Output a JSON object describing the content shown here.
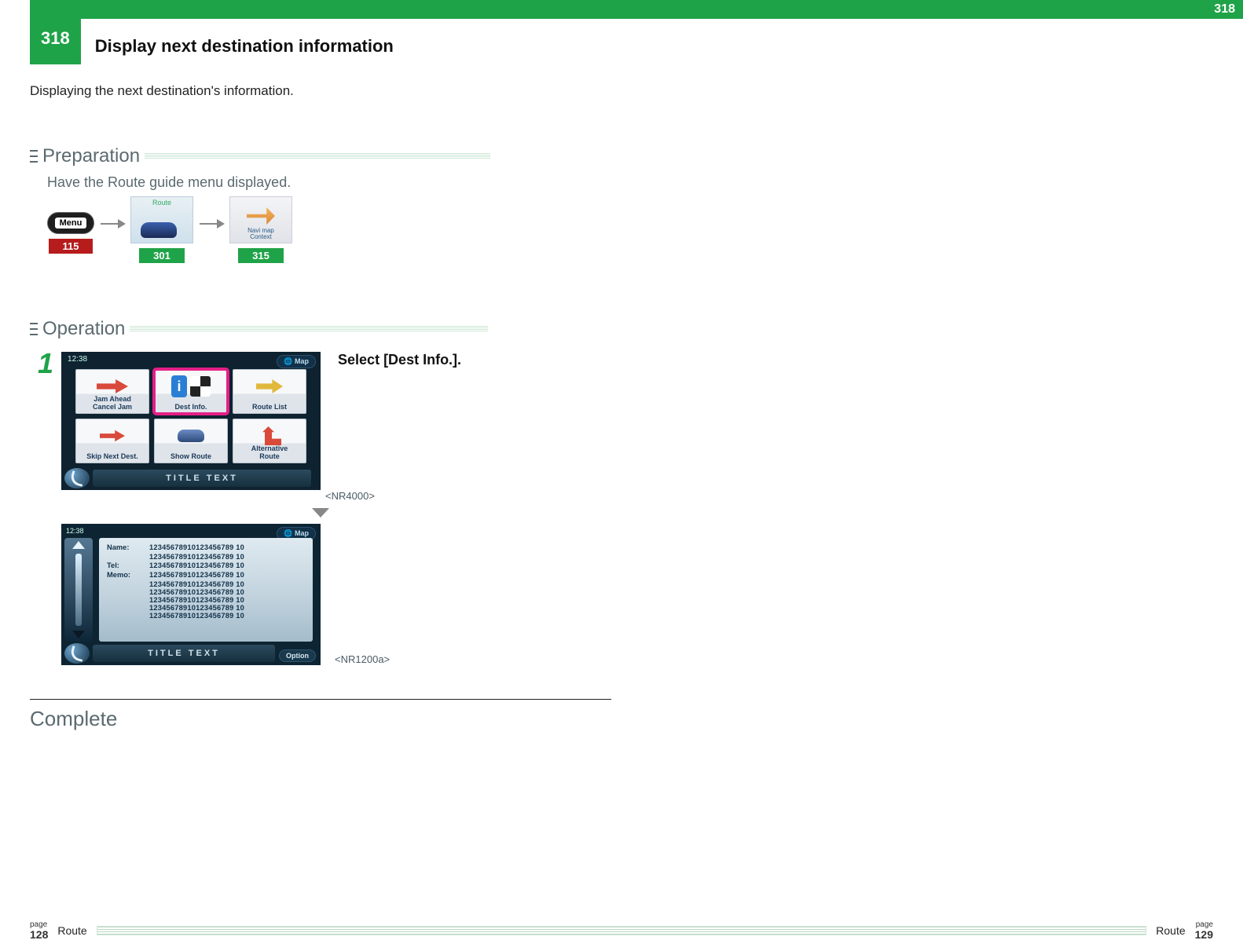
{
  "header": {
    "section_number_top": "318",
    "section_number": "318",
    "title": "Display next destination information"
  },
  "intro": "Displaying the next destination's information.",
  "sections": {
    "preparation": {
      "heading": "Preparation",
      "note": "Have the Route guide menu displayed.",
      "items": [
        {
          "label": "Menu",
          "ref": "115",
          "ref_style": "red"
        },
        {
          "label": "Route",
          "ref": "301",
          "ref_style": "green"
        },
        {
          "label_line1": "Navi map",
          "label_line2": "Context",
          "ref": "315",
          "ref_style": "green"
        }
      ]
    },
    "operation": {
      "heading": "Operation",
      "step_number": "1",
      "instruction": "Select [Dest Info.].",
      "screen1": {
        "clock": "12:38",
        "map_label": "Map",
        "tiles": [
          {
            "label_line1": "Jam Ahead",
            "label_line2": "Cancel Jam"
          },
          {
            "label_line1": "Dest Info.",
            "highlight": true
          },
          {
            "label_line1": "Route List"
          },
          {
            "label_line1": "Skip Next Dest."
          },
          {
            "label_line1": "Show Route"
          },
          {
            "label_line1": "Alternative",
            "label_line2": "Route"
          }
        ],
        "title_text": "TITLE TEXT",
        "caption": "<NR4000>"
      },
      "screen2": {
        "clock": "12:38",
        "map_label": "Map",
        "fields": {
          "name_key": "Name:",
          "tel_key": "Tel:",
          "memo_key": "Memo:",
          "value": "12345678910123456789 10",
          "extra_lines": 6
        },
        "title_text": "TITLE TEXT",
        "option_label": "Option",
        "caption": "<NR1200a>"
      }
    },
    "complete": "Complete"
  },
  "footer": {
    "left_page_label": "page",
    "left_page_num": "128",
    "section_name_left": "Route",
    "section_name_right": "Route",
    "right_page_label": "page",
    "right_page_num": "129"
  }
}
